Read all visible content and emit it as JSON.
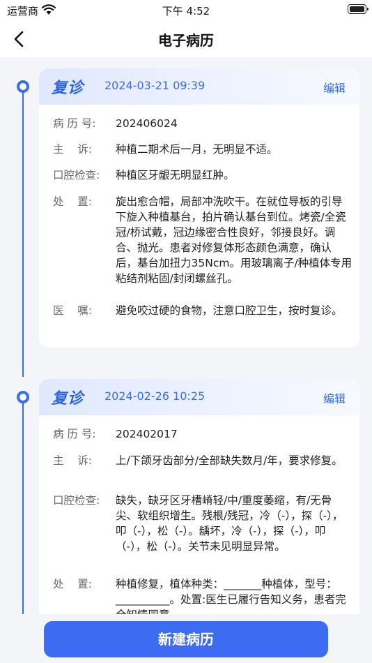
{
  "status_bar": {
    "carrier": "运营商",
    "time": "下午 4:52"
  },
  "header": {
    "title": "电子病历"
  },
  "records": [
    {
      "visit_type": "复诊",
      "datetime": "2024-03-21 09:39",
      "edit_label": "编辑",
      "fields": {
        "record_no": {
          "label": "病 历 号:",
          "value": "202406024"
        },
        "complaint": {
          "label": "主    诉:",
          "value": "种植二期术后一月，无明显不适。"
        },
        "oral_exam": {
          "label": "口腔检查:",
          "value": "种植区牙龈无明显红肿。"
        },
        "treatment": {
          "label": "处    置:",
          "value": "旋出愈合帽，局部冲洗吹干。在就位导板的引导下旋入种植基台，拍片确认基台到位。烤瓷/全瓷冠/桥试戴，冠边缘密合性良好，邻接良好。调合、抛光。患者对修复体形态颜色满意，确认后，基台加扭力35Ncm。用玻璃离子/种植体专用粘结剂粘固/封闭螺丝孔。"
        },
        "advice": {
          "label": "医    嘱:",
          "value": "避免咬过硬的食物，注意口腔卫生，按时复诊。"
        }
      }
    },
    {
      "visit_type": "复诊",
      "datetime": "2024-02-26 10:25",
      "edit_label": "编辑",
      "fields": {
        "record_no": {
          "label": "病 历 号:",
          "value": "202402017"
        },
        "complaint": {
          "label": "主    诉:",
          "value": "上/下颌牙齿部分/全部缺失数月/年，要求修复。"
        },
        "oral_exam": {
          "label": "口腔检查:",
          "value": "缺失，缺牙区牙槽嵴轻/中/重度萎缩，有/无骨尖、软组织增生。残根/残冠，冷（-），探（-），叩（-），松（-）。龋坏，冷（-），探（-），叩（-），松（-）。关节未见明显异常。"
        },
        "treatment": {
          "label": "处    置:",
          "value": "种植修复，植体种类：_______种植体，型号：__________。处置:医生已履行告知义务，患者完全知情同意"
        }
      }
    }
  ],
  "actions": {
    "new_record_label": "新建病历"
  },
  "colors": {
    "accent": "#3a6cf0",
    "button": "#3b6cf2",
    "background": "#f3f5f9"
  }
}
